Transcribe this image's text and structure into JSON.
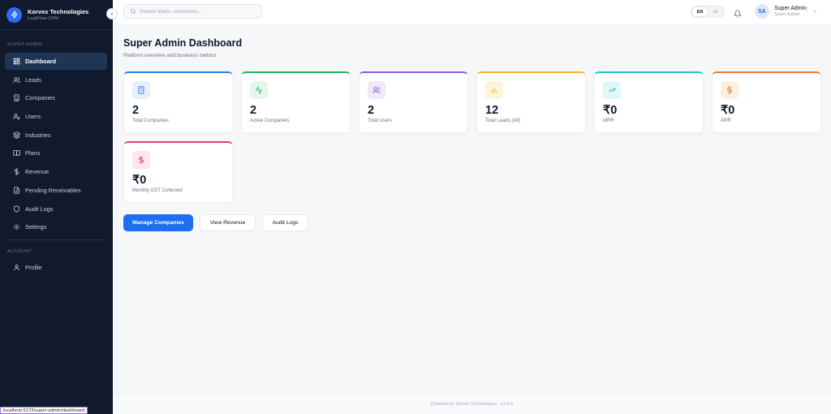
{
  "brand": {
    "name": "Korvex Technologies",
    "subtitle": "LeadFlow CRM"
  },
  "sidebar": {
    "section_admin": "SUPER ADMIN",
    "items": [
      {
        "label": "Dashboard",
        "icon": "dashboard-icon",
        "active": true
      },
      {
        "label": "Leads",
        "icon": "users-icon"
      },
      {
        "label": "Companies",
        "icon": "building-icon"
      },
      {
        "label": "Users",
        "icon": "user-cog-icon"
      },
      {
        "label": "Industries",
        "icon": "layers-icon"
      },
      {
        "label": "Plans",
        "icon": "book-icon"
      },
      {
        "label": "Revenue",
        "icon": "dollar-icon"
      },
      {
        "label": "Pending Receivables",
        "icon": "receipt-icon"
      },
      {
        "label": "Audit Logs",
        "icon": "shield-icon"
      },
      {
        "label": "Settings",
        "icon": "gear-icon"
      }
    ],
    "section_account": "ACCOUNT",
    "account_items": [
      {
        "label": "Profile",
        "icon": "user-icon"
      }
    ]
  },
  "topbar": {
    "search_placeholder": "Search leads, customers...",
    "lang_en": "EN",
    "lang_hi": "HI",
    "user_initials": "SA",
    "user_name": "Super Admin",
    "user_role": "Super Admin"
  },
  "main": {
    "title": "Super Admin Dashboard",
    "subtitle": "Platform overview and business metrics",
    "cards": [
      {
        "value": "2",
        "label": "Total Companies",
        "color": "#2f7be8",
        "icon": "building-icon"
      },
      {
        "value": "2",
        "label": "Active Companies",
        "color": "#22b45b",
        "icon": "activity-icon"
      },
      {
        "value": "2",
        "label": "Total Users",
        "color": "#8a63d8",
        "icon": "users-icon"
      },
      {
        "value": "12",
        "label": "Total Leads (All)",
        "color": "#f0b429",
        "icon": "bar-chart-icon"
      },
      {
        "value": "₹0",
        "label": "MRR",
        "color": "#22c3c9",
        "icon": "trending-up-icon"
      },
      {
        "value": "₹0",
        "label": "ARR",
        "color": "#f07f2b",
        "icon": "dollar-icon"
      },
      {
        "value": "₹0",
        "label": "Monthly GST Collected",
        "color": "#e0407a",
        "icon": "dollar-icon"
      }
    ],
    "buttons": {
      "manage": "Manage Companies",
      "revenue": "View Revenue",
      "audit": "Audit Logs"
    }
  },
  "footer": {
    "text": "Powered by Korvex Technologies · v1.0.0"
  },
  "status_url": "localhost:5173/super-admin/dashboard"
}
